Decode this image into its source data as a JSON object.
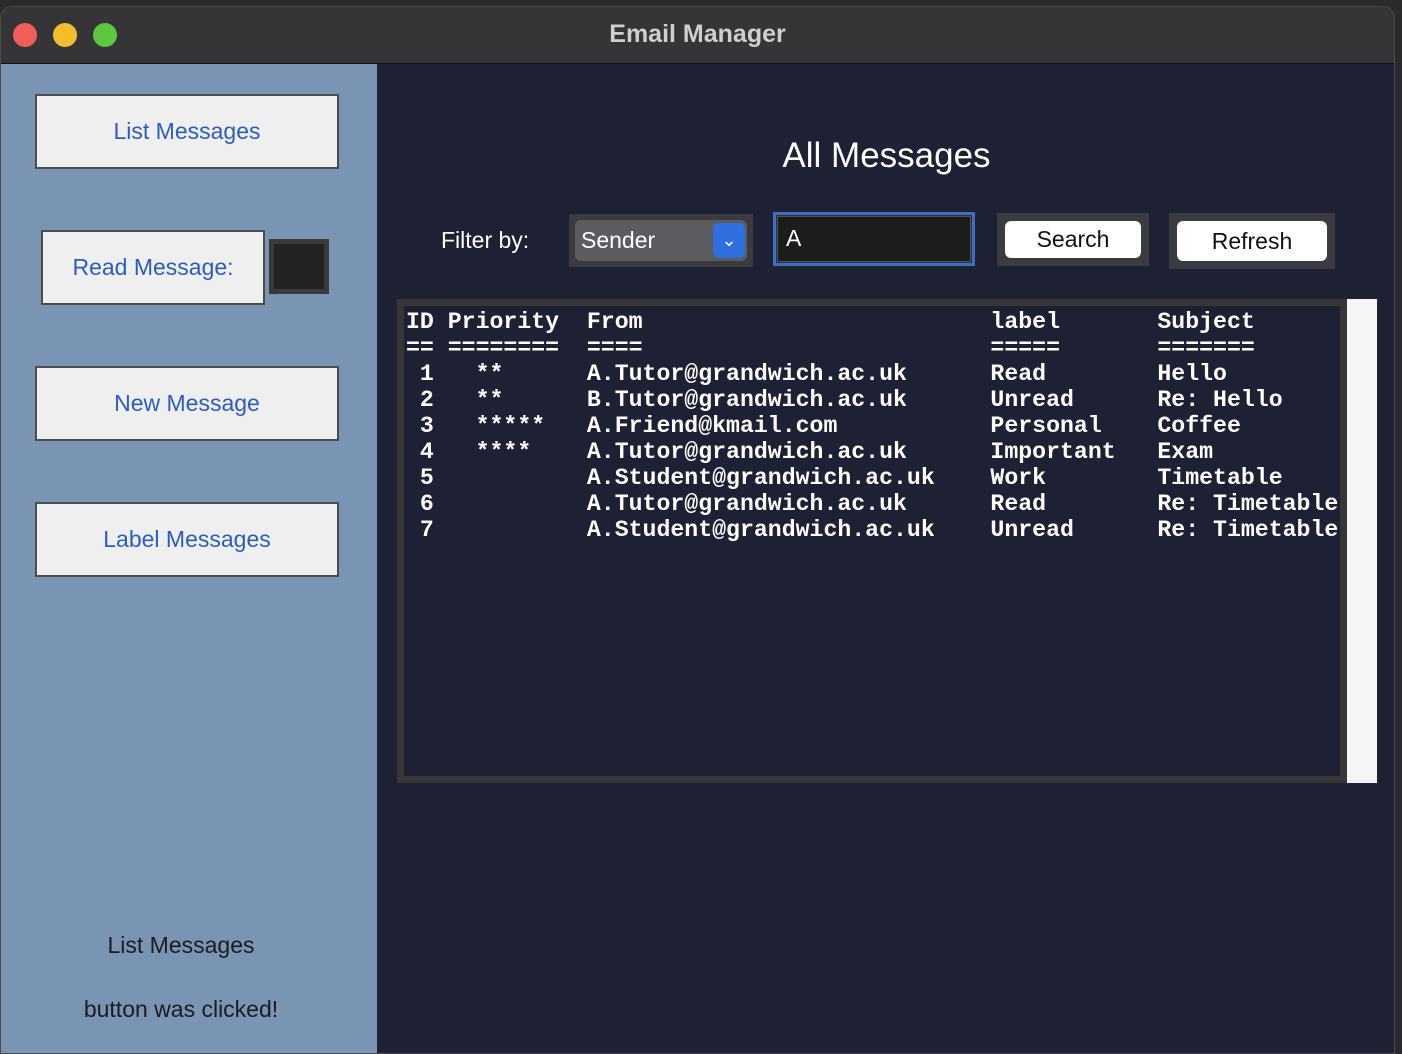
{
  "window": {
    "title": "Email Manager"
  },
  "sidebar": {
    "list_button": "List Messages",
    "read_button": "Read Message:",
    "read_id_value": "",
    "new_button": "New Message",
    "label_button": "Label Messages",
    "status_line_1": "List Messages",
    "status_line_2": "button was clicked!"
  },
  "main": {
    "title": "All Messages",
    "filter_label": "Filter by:",
    "filter_value": "Sender",
    "search_value": "A",
    "search_button": "Search",
    "refresh_button": "Refresh",
    "messages_text": "ID Priority  From                         label       Subject\n== ========  ====                         =====       =======\n 1   **      A.Tutor@grandwich.ac.uk      Read        Hello\n 2   **      B.Tutor@grandwich.ac.uk      Unread      Re: Hello\n 3   *****   A.Friend@kmail.com           Personal    Coffee\n 4   ****    A.Tutor@grandwich.ac.uk      Important   Exam\n 5           A.Student@grandwich.ac.uk    Work        Timetable\n 6           A.Tutor@grandwich.ac.uk      Read        Re: Timetable\n 7           A.Student@grandwich.ac.uk    Unread      Re: Timetable"
  },
  "colors": {
    "sidebar_bg": "#7a94b4",
    "main_bg": "#1e2033",
    "sidebar_button_text": "#2d5bc4",
    "select_accent": "#2f6fe0"
  }
}
